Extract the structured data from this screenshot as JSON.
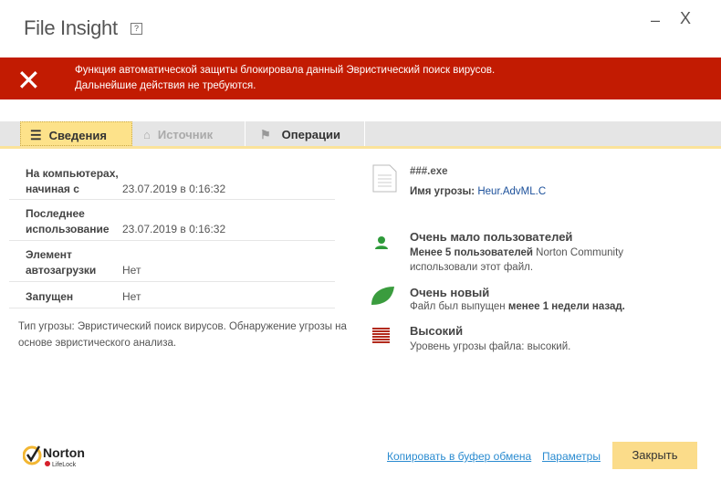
{
  "window": {
    "title": "File Insight",
    "help": "?",
    "minimize": "–",
    "close": "X"
  },
  "banner": {
    "line1": "Функция автоматической защиты блокировала данный Эвристический поиск вирусов.",
    "line2": "Дальнейшие действия не требуются.",
    "color": "#c21b02"
  },
  "tabs": [
    {
      "label": "Сведения"
    },
    {
      "label": "Источник"
    },
    {
      "label": "Операции"
    }
  ],
  "details": [
    {
      "label1": "На компьютерах,",
      "label2": "начиная с",
      "value": "23.07.2019 в 0:16:32"
    },
    {
      "label1": "Последнее",
      "label2": "использование",
      "value": "23.07.2019 в 0:16:32"
    },
    {
      "label1": "Элемент",
      "label2": "автозагрузки",
      "value": "Нет"
    },
    {
      "label1": "Запущен",
      "label2": "",
      "value": "Нет"
    }
  ],
  "note": "Тип угрозы: Эвристический поиск вирусов. Обнаружение угрозы на основе эвристического анализа.",
  "file": {
    "name": "###.exe",
    "threat_label": "Имя угрозы:",
    "threat_name": "Heur.AdvML.C"
  },
  "users": {
    "title": "Очень мало пользователей",
    "bold": "Менее 5 пользователей",
    "rest": " Norton Community",
    "line2": "использовали этот файл."
  },
  "age": {
    "title": "Очень новый",
    "text": "Файл был выпущен ",
    "bold": "менее 1 недели назад."
  },
  "risk": {
    "title": "Высокий",
    "text": "Уровень угрозы файла: высокий."
  },
  "footer": {
    "logo": "Norton LifeLock",
    "copy": "Копировать в буфер обмена",
    "settings": "Параметры",
    "close": "Закрыть"
  }
}
